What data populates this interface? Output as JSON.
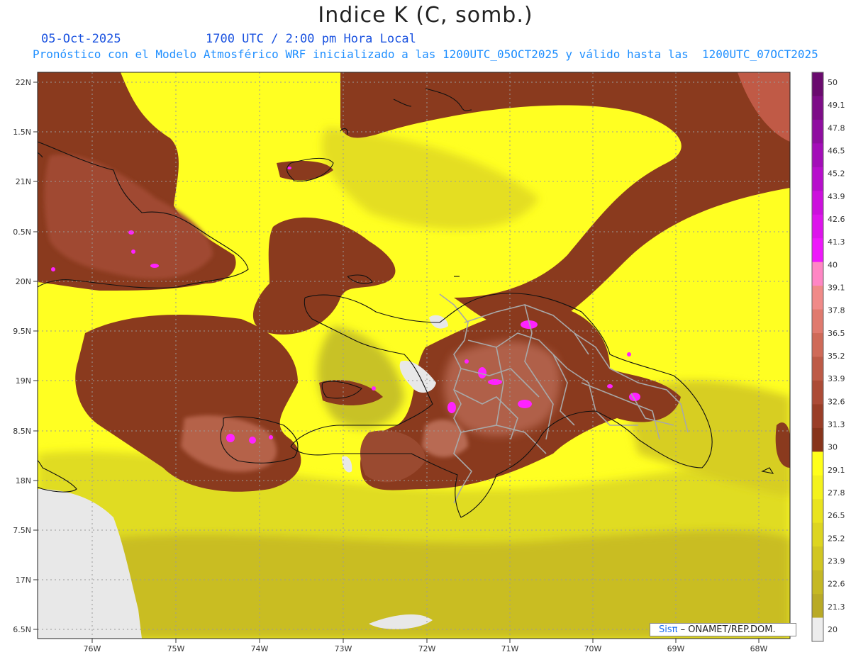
{
  "title": "Indice K (C, somb.)",
  "date": "05-Oct-2025",
  "time_label": "1700 UTC / 2:00 pm Hora Local",
  "description": "Pronóstico con el Modelo Atmosférico WRF inicializado a las 1200UTC_05OCT2025 y válido hasta las  1200UTC_07OCT2025",
  "lat_labels": [
    "22N",
    "1.5N",
    "21N",
    "0.5N",
    "20N",
    "9.5N",
    "19N",
    "8.5N",
    "18N",
    "7.5N",
    "17N",
    "6.5N"
  ],
  "lon_labels": [
    "76W",
    "75W",
    "74W",
    "73W",
    "72W",
    "71W",
    "70W",
    "69W",
    "68W"
  ],
  "colorbar": {
    "labels": [
      "50",
      "49.1",
      "47.8",
      "46.5",
      "45.2",
      "43.9",
      "42.6",
      "41.3",
      "40",
      "39.1",
      "37.8",
      "36.5",
      "35.2",
      "33.9",
      "32.6",
      "31.3",
      "30",
      "29.1",
      "27.8",
      "26.5",
      "25.2",
      "23.9",
      "22.6",
      "21.3",
      "20"
    ],
    "colors": [
      "#6a0a6e",
      "#7d0c87",
      "#8f0da0",
      "#a30db8",
      "#b70ecc",
      "#cc10dd",
      "#dd14ec",
      "#ee18fb",
      "#ff86c4",
      "#f08a88",
      "#e07a6e",
      "#cf6a58",
      "#bd5a46",
      "#ac4b36",
      "#9a3e27",
      "#87341b",
      "#ffff1a",
      "#f4f21c",
      "#e9e31e",
      "#ddd520",
      "#d1c622",
      "#c5b824",
      "#b9aa26",
      "#ededed"
    ]
  },
  "credit": {
    "brand": "Sisπ",
    "text": " – ONAMET/REP.DOM."
  }
}
